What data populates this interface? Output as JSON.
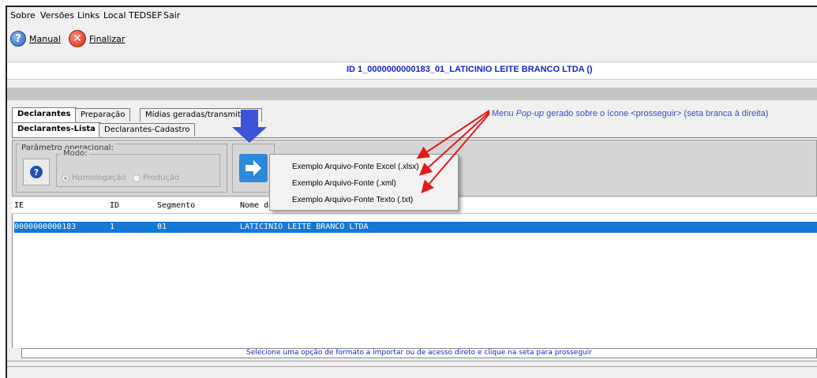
{
  "menubar": {
    "items": [
      "Sobre",
      "Versões",
      "Links",
      "Local TEDSEF",
      "Sair"
    ]
  },
  "toolbar": {
    "manual_label": "Manual",
    "finalizar_label": "Finalizar"
  },
  "title": "ID 1_0000000000183_01_LATICINIO LEITE BRANCO LTDA ()",
  "tabs_main": [
    "Declarantes",
    "Preparação",
    "Mídias geradas/transmitidas"
  ],
  "tabs_sub": [
    "Declarantes-Lista",
    "Declarantes-Cadastro"
  ],
  "param": {
    "legend": "Parâmetro operacional:",
    "modo_legend": "Modo:",
    "radio_homologacao": "Homologação",
    "radio_producao": "Produção",
    "selected": "Homologação"
  },
  "table": {
    "headers": [
      "IE",
      "ID",
      "Segmento",
      "Nome do declarante"
    ],
    "rows": [
      [
        "0000000000183",
        "1",
        "01",
        "LATICINIO LEITE BRANCO LTDA"
      ]
    ]
  },
  "status_text": "Selecione uma opção de formato a importar ou de acesso direto e clique na seta para prosseguir",
  "popup": {
    "items": [
      "Exemplo Arquivo-Fonte Excel (.xlsx)",
      "Exemplo Arquivo-Fonte (.xml)",
      "Exemplo Arquivo-Fonte Texto (.txt)"
    ]
  },
  "annotation": {
    "prefix": "Menu ",
    "italic": "Pop-up",
    "suffix": " gerado sobre o ícone <prosseguir> (seta branca à direita)"
  },
  "colors": {
    "selection": "#1478d4",
    "title_text": "#1226c8",
    "annotation_arrow": "#e01b1b",
    "indicator_arrow": "#3b55d6"
  }
}
